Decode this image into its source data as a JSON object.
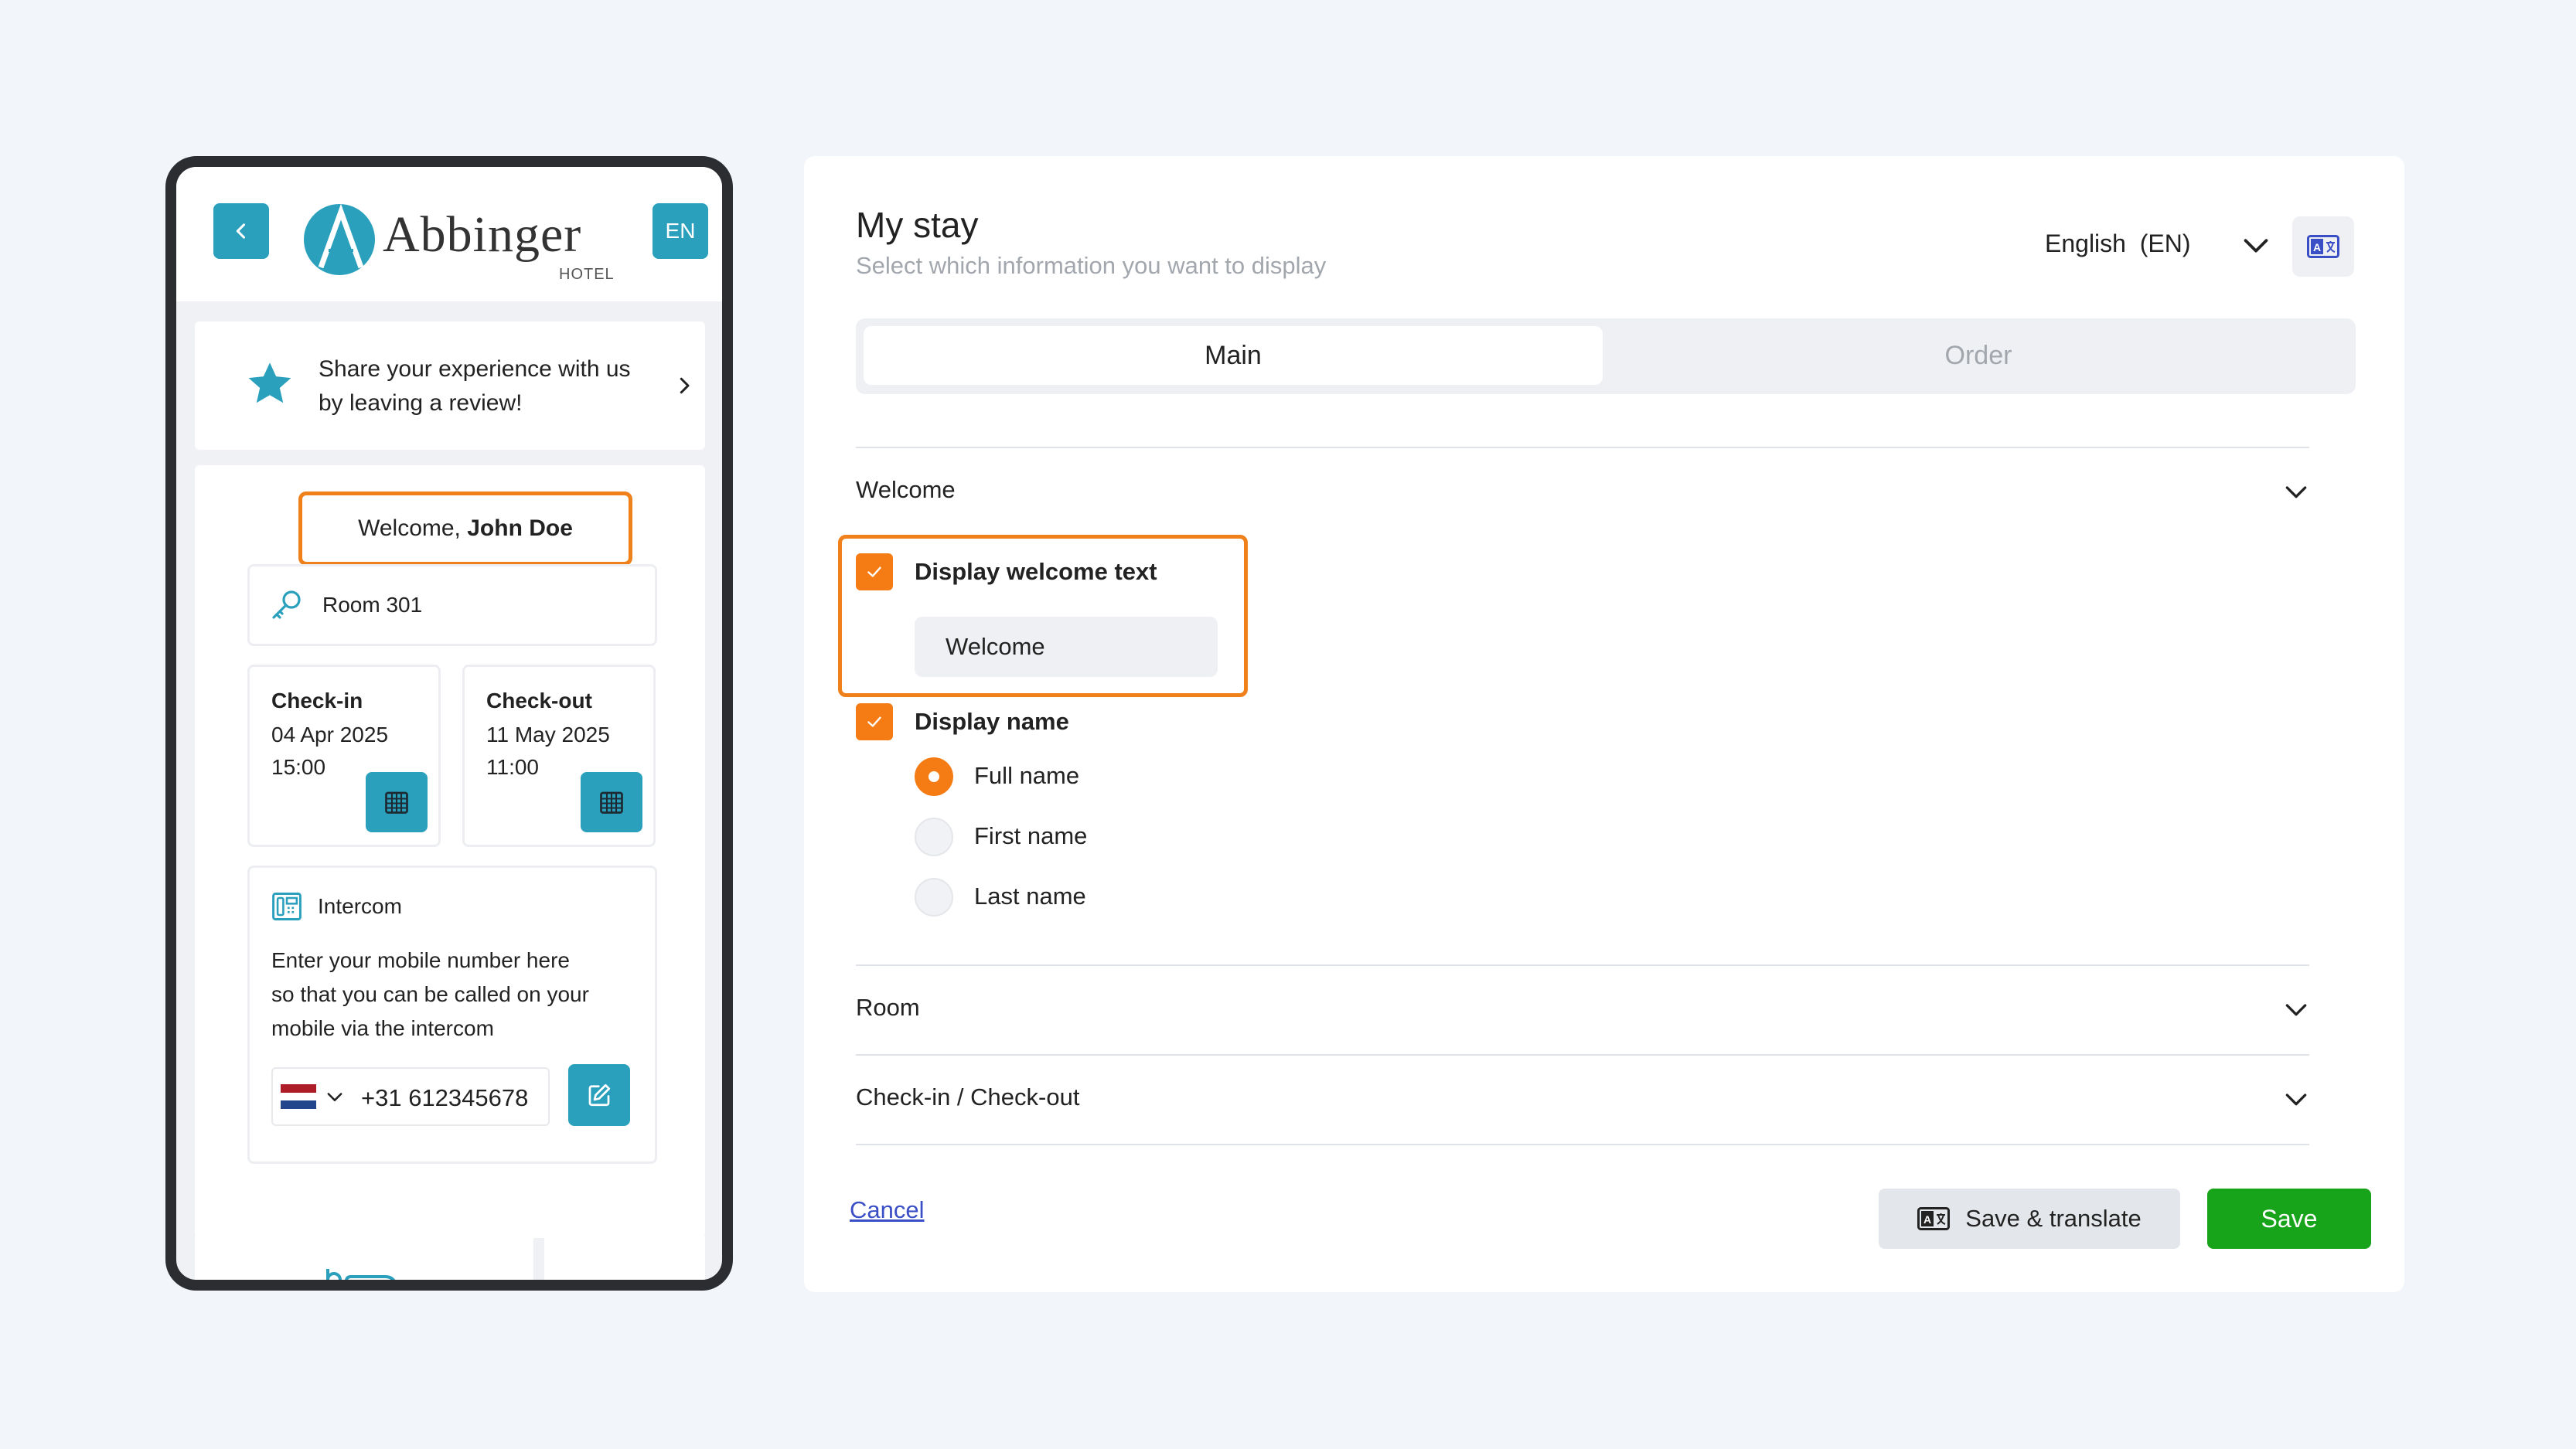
{
  "phone": {
    "back_label": "<",
    "lang_button": "EN",
    "logo_letter": "A",
    "logo_name": "Abbinger",
    "logo_sub": "HOTEL",
    "review_line1": "Share your experience with us",
    "review_line2": "by leaving a review!",
    "welcome_prefix": "Welcome, ",
    "welcome_name": "John Doe",
    "room": "Room 301",
    "checkin_label": "Check-in",
    "checkin_date": "04 Apr 2025",
    "checkin_time": "15:00",
    "checkout_label": "Check-out",
    "checkout_date": "11 May 2025",
    "checkout_time": "11:00",
    "intercom_title": "Intercom",
    "intercom_line1": "Enter your mobile number here",
    "intercom_line2": "so that you can be called on your",
    "intercom_line3": "mobile via the intercom",
    "phone_number": "+31 612345678"
  },
  "panel": {
    "title": "My stay",
    "subtitle": "Select which information you want to display",
    "language": "English  (EN)",
    "tabs": [
      {
        "label": "Main",
        "active": true
      },
      {
        "label": "Order",
        "active": false
      }
    ],
    "sections": {
      "welcome": "Welcome",
      "room": "Room",
      "checkinout": "Check-in / Check-out"
    },
    "display_welcome_text": "Display welcome text",
    "welcome_value": "Welcome",
    "display_name": "Display name",
    "name_options": [
      {
        "label": "Full name",
        "selected": true
      },
      {
        "label": "First name",
        "selected": false
      },
      {
        "label": "Last name",
        "selected": false
      }
    ],
    "cancel": "Cancel",
    "save_translate": "Save & translate",
    "save": "Save"
  },
  "colors": {
    "accent_teal": "#2aa0bd",
    "highlight_orange": "#f08019",
    "checkbox_orange": "#f57c14",
    "save_green": "#17a31a",
    "link_blue": "#3a4fc6"
  }
}
